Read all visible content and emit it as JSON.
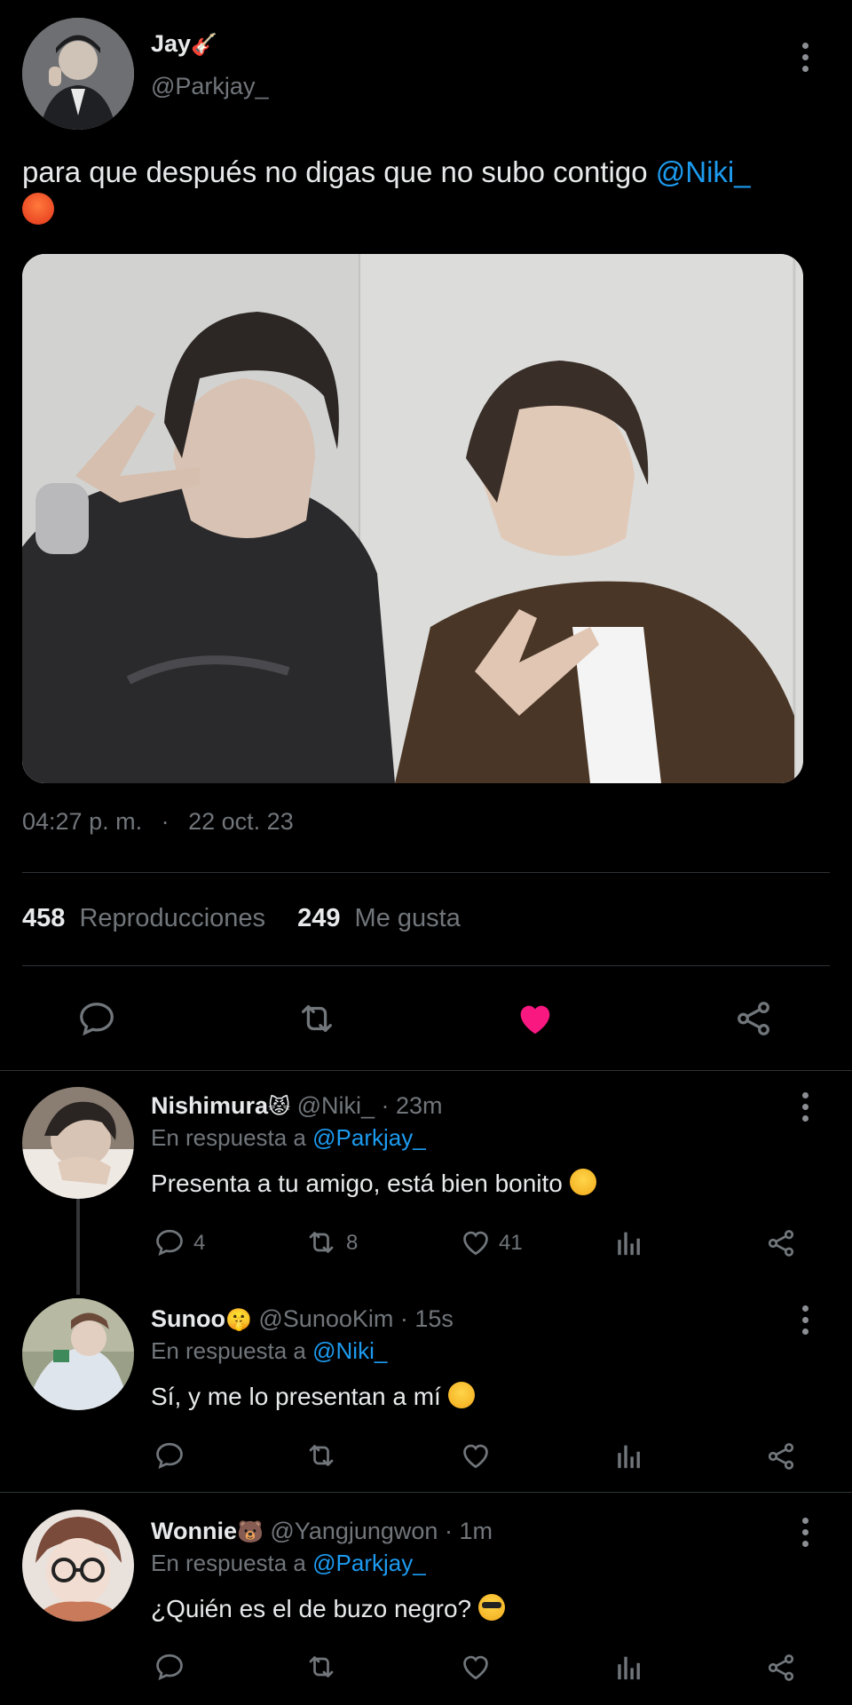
{
  "tweet": {
    "author_name": "Jay",
    "author_name_emoji": "🎸",
    "author_handle": "@Parkjay_",
    "text": "para que después no digas que no subo contigo",
    "mention": "@Niki_",
    "text_emoji": "😡",
    "time": "04:27 p. m.",
    "separator": "·",
    "date": "22 oct. 23",
    "views_count": "458",
    "views_label": "Reproducciones",
    "likes_count": "249",
    "likes_label": "Me gusta",
    "liked": true
  },
  "colors": {
    "background": "#000000",
    "text": "#e7e9ea",
    "muted": "#71767b",
    "link": "#1d9bf0",
    "like": "#f91880",
    "divider": "#2f3336"
  },
  "replies": [
    {
      "name": "Nishimura",
      "name_emoji": "😾",
      "handle": "@Niki_",
      "time": "· 23m",
      "reply_prefix": "En respuesta a",
      "reply_to": "@Parkjay_",
      "text": "Presenta a tu amigo, está bien bonito",
      "text_emoji": "😊",
      "replies": "4",
      "retweets": "8",
      "likes": "41"
    },
    {
      "name": "Sunoo",
      "name_emoji": "🤫",
      "handle": "@SunooKim",
      "time": "· 15s",
      "reply_prefix": "En respuesta a",
      "reply_to": "@Niki_",
      "text": "Sí, y me lo presentan a mí",
      "text_emoji": "😊",
      "replies": "",
      "retweets": "",
      "likes": ""
    },
    {
      "name": "Wonnie",
      "name_emoji": "🐻",
      "handle": "@Yangjungwon",
      "time": "· 1m",
      "reply_prefix": "En respuesta a",
      "reply_to": "@Parkjay_",
      "text": "¿Quién es el de buzo negro?",
      "text_emoji": "😎",
      "replies": "",
      "retweets": "",
      "likes": ""
    }
  ],
  "icons": {
    "tweet_actions": [
      "reply-icon",
      "retweet-icon",
      "heart-filled-icon",
      "share-icon"
    ],
    "reply_actions": [
      "reply-icon",
      "retweet-icon",
      "heart-icon",
      "analytics-icon",
      "share-icon"
    ]
  }
}
